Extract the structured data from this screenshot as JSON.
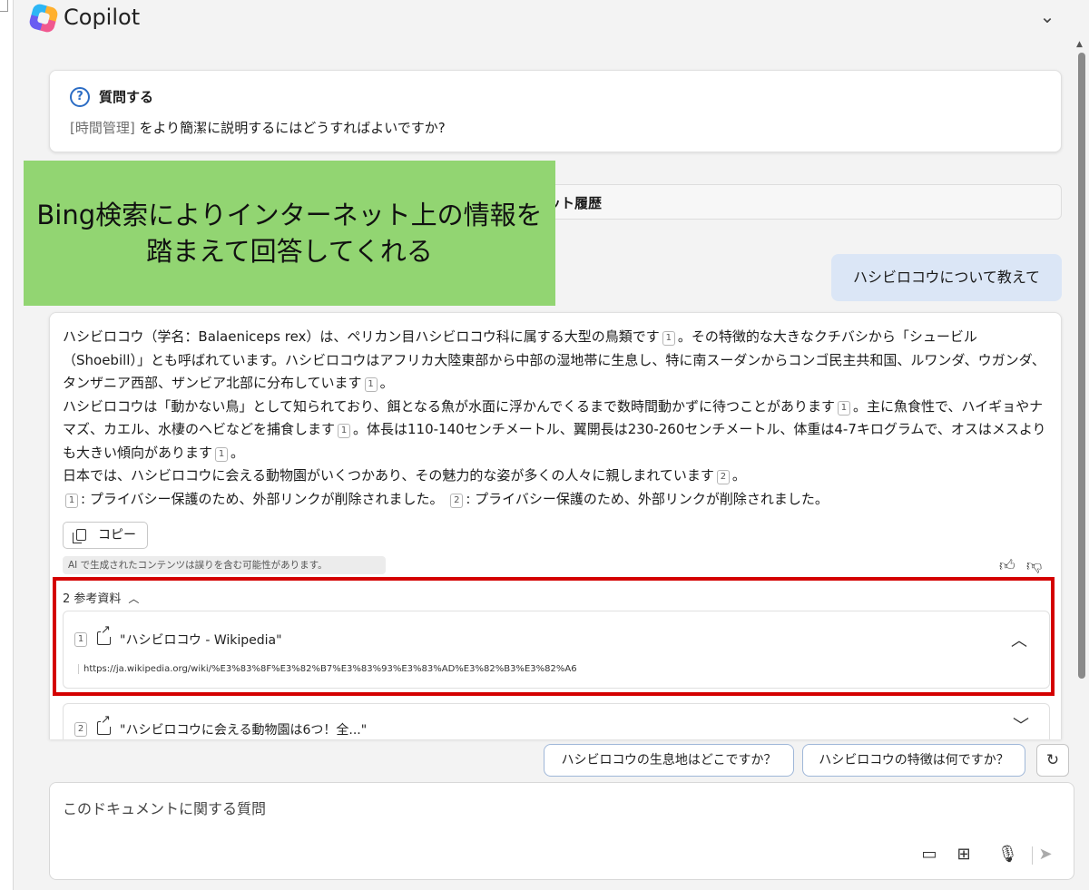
{
  "app": {
    "title": "Copilot",
    "window_chevron": "chevron-down-icon"
  },
  "ask_card": {
    "title": "質問する",
    "tag": "[時間管理]",
    "text": " をより簡潔に説明するにはどうすればよいですか?"
  },
  "history_label": "ット履歴",
  "callout": {
    "line1": "Bing検索によりインターネット上の情報を",
    "line2": "踏まえて回答してくれる"
  },
  "user_message": "ハシビロコウについて教えて",
  "answer": {
    "para1a": "ハシビロコウ（学名：Balaeniceps rex）は、ペリカン目ハシビロコウ科に属する大型の鳥類です",
    "para1b": "。その特徴的な大きなクチバシから「シュービル（Shoebill）」とも呼ばれています。ハシビロコウはアフリカ大陸東部から中部の湿地帯に生息し、特に南スーダンからコンゴ民主共和国、ルワンダ、ウガンダ、タンザニア西部、ザンビア北部に分布しています",
    "para1c": "。",
    "para2a": "ハシビロコウは「動かない鳥」として知られており、餌となる魚が水面に浮かんでくるまで数時間動かずに待つことがあります",
    "para2b": "。主に魚食性で、ハイギョやナマズ、カエル、水棲のヘビなどを捕食します",
    "para2c": "。体長は110-140センチメートル、翼開長は230-260センチメートル、体重は4-7キログラムで、オスはメスよりも大きい傾向があります",
    "para2d": "。",
    "para3a": "日本では、ハシビロコウに会える動物園がいくつかあり、その魅力的な姿が多くの人々に親しまれています",
    "para3b": "。",
    "note1": ": プライバシー保護のため、外部リンクが削除されました。",
    "note2": ": プライバシー保護のため、外部リンクが削除されました。",
    "ref1": "1",
    "ref2": "2"
  },
  "copy_label": "コピー",
  "disclaimer": "AI で生成されたコンテンツは誤りを含む可能性があります。",
  "references": {
    "header": "2 参考資料",
    "items": [
      {
        "num": "1",
        "title": "\"ハシビロコウ - Wikipedia\"",
        "url": "https://ja.wikipedia.org/wiki/%E3%83%8F%E3%82%B7%E3%83%93%E3%83%AD%E3%82%B3%E3%82%A6"
      },
      {
        "num": "2",
        "title": "\"ハシビロコウに会える動物園は6つ！全...\""
      }
    ]
  },
  "suggestions": [
    "ハシビロコウの生息地はどこですか？",
    "ハシビロコウの特徴は何ですか？"
  ],
  "input": {
    "placeholder": "このドキュメントに関する質問"
  },
  "colors": {
    "callout_bg": "#92d572",
    "highlight_border": "#d40000",
    "user_bubble": "#dbe6f6",
    "accent": "#2b6cc4"
  }
}
